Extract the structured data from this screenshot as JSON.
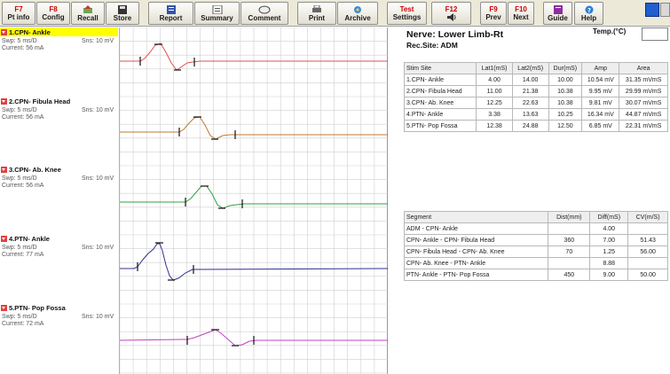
{
  "toolbar": {
    "buttons": [
      {
        "key": "F7",
        "label": "Pt info"
      },
      {
        "key": "F8",
        "label": "Config"
      },
      {
        "key": "",
        "label": "Recall"
      },
      {
        "key": "",
        "label": "Store"
      },
      {
        "key": "",
        "label": "Report"
      },
      {
        "key": "",
        "label": "Summary"
      },
      {
        "key": "",
        "label": "Comment"
      },
      {
        "key": "",
        "label": "Print"
      },
      {
        "key": "",
        "label": "Archive"
      },
      {
        "key": "Test",
        "label": "Settings"
      },
      {
        "key": "F12",
        "label": ""
      },
      {
        "key": "F9",
        "label": "Prev"
      },
      {
        "key": "F10",
        "label": "Next"
      },
      {
        "key": "",
        "label": "Guide"
      },
      {
        "key": "",
        "label": "Help"
      }
    ]
  },
  "traces": [
    {
      "name": "1.CPN- Ankle",
      "sweep": "Swp: 5 ms/D",
      "sens": "Sns: 10 mV",
      "current": "Current: 56 mA",
      "color": "#e05050"
    },
    {
      "name": "2.CPN- Fibula Head",
      "sweep": "Swp: 5 ms/D",
      "sens": "Sns: 10 mV",
      "current": "Current: 56 mA",
      "color": "#c07830"
    },
    {
      "name": "3.CPN- Ab. Knee",
      "sweep": "Swp: 5 ms/D",
      "sens": "Sns: 10 mV",
      "current": "Current: 56 mA",
      "color": "#30a040"
    },
    {
      "name": "4.PTN- Ankle",
      "sweep": "Swp: 5 ms/D",
      "sens": "Sns: 10 mV",
      "current": "Current: 77 mA",
      "color": "#303090"
    },
    {
      "name": "5.PTN- Pop Fossa",
      "sweep": "Swp: 5 ms/D",
      "sens": "Sns: 10 mV",
      "current": "Current: 72 mA",
      "color": "#c040c0"
    }
  ],
  "header": {
    "nerve": "Nerve: Lower Limb-Rt",
    "rec_site": "Rec.Site: ADM",
    "temp_label": "Temp.(°C)",
    "temp_value": ""
  },
  "stim_table": {
    "headers": [
      "Stim Site",
      "Lat1(mS)",
      "Lat2(mS)",
      "Dur(mS)",
      "Amp",
      "Area"
    ],
    "rows": [
      [
        "1.CPN- Ankle",
        "4.00",
        "14.00",
        "10.00",
        "10.54 mV",
        "31.35 mVmS"
      ],
      [
        "2.CPN- Fibula Head",
        "11.00",
        "21.38",
        "10.38",
        "9.95 mV",
        "29.99 mVmS"
      ],
      [
        "3.CPN- Ab. Knee",
        "12.25",
        "22.63",
        "10.38",
        "9.81 mV",
        "30.07 mVmS"
      ],
      [
        "4.PTN- Ankle",
        "3.38",
        "13.63",
        "10.25",
        "16.34 mV",
        "44.87 mVmS"
      ],
      [
        "5.PTN- Pop Fossa",
        "12.38",
        "24.88",
        "12.50",
        "6.85 mV",
        "22.31 mVmS"
      ]
    ]
  },
  "segment_table": {
    "headers": [
      "Segment",
      "Dist(mm)",
      "Diff(mS)",
      "CV(m/S)"
    ],
    "rows": [
      [
        "ADM - CPN- Ankle",
        "",
        "4.00",
        ""
      ],
      [
        "CPN- Ankle - CPN- Fibula Head",
        "360",
        "7.00",
        "51.43"
      ],
      [
        "CPN- Fibula Head - CPN- Ab. Knee",
        "70",
        "1.25",
        "56.00"
      ],
      [
        "CPN- Ab. Knee - PTN- Ankle",
        "",
        "8.88",
        ""
      ],
      [
        "PTN- Ankle - PTN- Pop Fossa",
        "450",
        "9.00",
        "50.00"
      ]
    ]
  }
}
